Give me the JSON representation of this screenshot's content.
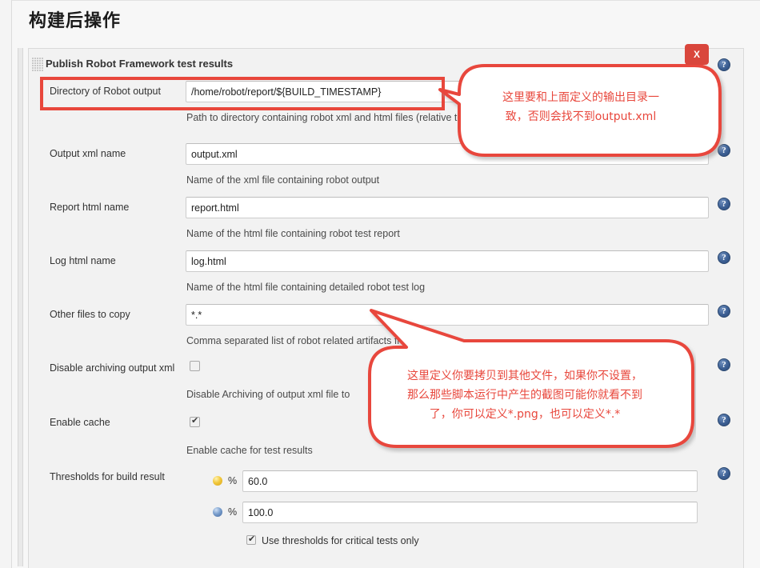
{
  "page": {
    "title": "构建后操作"
  },
  "panel": {
    "heading": "Publish Robot Framework test results",
    "close_label": "X",
    "help_glyph": "?"
  },
  "fields": [
    {
      "label": "Directory of Robot output",
      "value": "/home/robot/report/${BUILD_TIMESTAMP}",
      "hint": "Path to directory containing robot xml and html files (relative to b"
    },
    {
      "label": "Output xml name",
      "value": "output.xml",
      "hint": "Name of the xml file containing robot output"
    },
    {
      "label": "Report html name",
      "value": "report.html",
      "hint": "Name of the html file containing robot test report"
    },
    {
      "label": "Log html name",
      "value": "log.html",
      "hint": "Name of the html file containing detailed robot test log"
    },
    {
      "label": "Other files to copy",
      "value": "*.*",
      "hint": "Comma separated list of robot related artifacts fro"
    }
  ],
  "checkboxes": [
    {
      "label": "Disable archiving output xml",
      "checked": false,
      "hint": "Disable Archiving of output xml file to"
    },
    {
      "label": "Enable cache",
      "checked": true,
      "hint": "Enable cache for test results"
    }
  ],
  "thresholds": {
    "label": "Thresholds for build result",
    "percent_sign": "%",
    "passed_value": "60.0",
    "unstable_value": "100.0",
    "critical_only_label": "Use thresholds for critical tests only",
    "critical_only_checked": true
  },
  "annotations": [
    {
      "name": "output-dir-callout",
      "text": "这里要和上面定义的输出目录一\n致，否则会找不到output.xml",
      "color": "#e8473c"
    },
    {
      "name": "other-files-callout",
      "text": "这里定义你要拷贝到其他文件，如果你不设置，\n那么那些脚本运行中产生的截图可能你就看不到\n了，你可以定义*.png，也可以定义*.*",
      "color": "#e8473c"
    }
  ],
  "colors": {
    "accent_red": "#e8473c",
    "help_blue": "#3c5f93",
    "panel_bg": "#f2f2f2",
    "threshold_gold": "#f2c83c",
    "threshold_blue": "#7b9fcd"
  }
}
